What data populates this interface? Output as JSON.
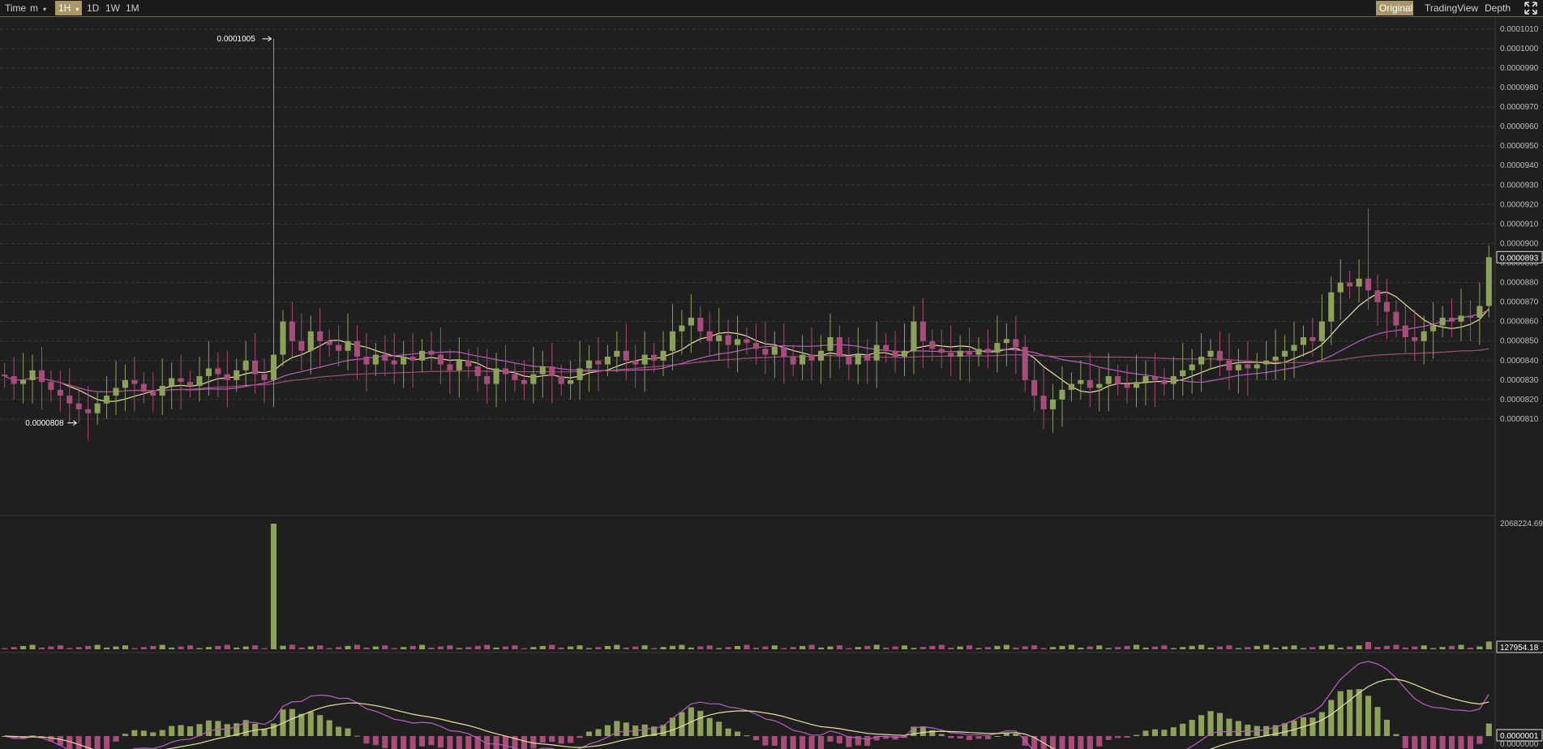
{
  "toolbar": {
    "time_label": "Time",
    "minute_label": "m",
    "interval_active": "1H",
    "interval_buttons": [
      "1D",
      "1W",
      "1M"
    ],
    "view_buttons": [
      "Original",
      "TradingView",
      "Depth"
    ],
    "active_view": "Original"
  },
  "colors": {
    "up": "#8ea15a",
    "down": "#a84c79",
    "ma_fast": "#e9df9f",
    "ma_mid": "#b85fc2",
    "ma_slow": "#a04f79",
    "grid": "#3a3a3a",
    "background": "#1f1f1f",
    "accent": "#a89668"
  },
  "chart_data": [
    {
      "type": "candlestick",
      "panel": "price",
      "title": "",
      "ylim": [
        8.05e-05,
        0.0001012
      ],
      "y_ticks": [
        "0.0001010",
        "0.0001000",
        "0.0000990",
        "0.0000980",
        "0.0000970",
        "0.0000960",
        "0.0000950",
        "0.0000940",
        "0.0000930",
        "0.0000920",
        "0.0000910",
        "0.0000900",
        "0.0000890",
        "0.0000880",
        "0.0000870",
        "0.0000860",
        "0.0000850",
        "0.0000840",
        "0.0000830",
        "0.0000820",
        "0.0000810"
      ],
      "grid": true,
      "candle_count": 165,
      "close_estimates": [
        8.32e-05,
        8.28e-05,
        8.3e-05,
        8.35e-05,
        8.29e-05,
        8.25e-05,
        8.22e-05,
        8.18e-05,
        8.15e-05,
        8.13e-05,
        8.18e-05,
        8.22e-05,
        8.26e-05,
        8.3e-05,
        8.28e-05,
        8.24e-05,
        8.22e-05,
        8.27e-05,
        8.31e-05,
        8.29e-05,
        8.27e-05,
        8.32e-05,
        8.36e-05,
        8.33e-05,
        8.3e-05,
        8.35e-05,
        8.4e-05,
        8.33e-05,
        8.3e-05,
        8.43e-05,
        8.6e-05,
        8.5e-05,
        8.45e-05,
        8.55e-05,
        8.5e-05,
        8.48e-05,
        8.45e-05,
        8.5e-05,
        8.42e-05,
        8.38e-05,
        8.43e-05,
        8.4e-05,
        8.38e-05,
        8.42e-05,
        8.4e-05,
        8.45e-05,
        8.43e-05,
        8.38e-05,
        8.35e-05,
        8.4e-05,
        8.37e-05,
        8.32e-05,
        8.28e-05,
        8.36e-05,
        8.33e-05,
        8.3e-05,
        8.28e-05,
        8.33e-05,
        8.37e-05,
        8.32e-05,
        8.28e-05,
        8.3e-05,
        8.36e-05,
        8.4e-05,
        8.38e-05,
        8.42e-05,
        8.45e-05,
        8.4e-05,
        8.38e-05,
        8.43e-05,
        8.4e-05,
        8.45e-05,
        8.55e-05,
        8.58e-05,
        8.62e-05,
        8.55e-05,
        8.5e-05,
        8.53e-05,
        8.48e-05,
        8.51e-05,
        8.49e-05,
        8.46e-05,
        8.43e-05,
        8.47e-05,
        8.42e-05,
        8.38e-05,
        8.43e-05,
        8.4e-05,
        8.45e-05,
        8.52e-05,
        8.42e-05,
        8.38e-05,
        8.43e-05,
        8.4e-05,
        8.48e-05,
        8.45e-05,
        8.42e-05,
        8.45e-05,
        8.6e-05,
        8.5e-05,
        8.46e-05,
        8.44e-05,
        8.42e-05,
        8.45e-05,
        8.43e-05,
        8.46e-05,
        8.44e-05,
        8.49e-05,
        8.51e-05,
        8.47e-05,
        8.3e-05,
        8.22e-05,
        8.15e-05,
        8.2e-05,
        8.25e-05,
        8.28e-05,
        8.3e-05,
        8.26e-05,
        8.28e-05,
        8.32e-05,
        8.28e-05,
        8.26e-05,
        8.29e-05,
        8.32e-05,
        8.3e-05,
        8.28e-05,
        8.32e-05,
        8.35e-05,
        8.38e-05,
        8.42e-05,
        8.45e-05,
        8.4e-05,
        8.35e-05,
        8.38e-05,
        8.36e-05,
        8.38e-05,
        8.4e-05,
        8.42e-05,
        8.45e-05,
        8.48e-05,
        8.52e-05,
        8.5e-05,
        8.6e-05,
        8.75e-05,
        8.8e-05,
        8.78e-05,
        8.82e-05,
        8.76e-05,
        8.7e-05,
        8.65e-05,
        8.58e-05,
        8.52e-05,
        8.5e-05,
        8.55e-05,
        8.58e-05,
        8.62e-05,
        8.6e-05,
        8.63e-05,
        8.62e-05,
        8.68e-05,
        8.93e-05
      ],
      "annotations": [
        {
          "label": "0.0001005",
          "value": 0.0001005,
          "kind": "high"
        },
        {
          "label": "0.0000808",
          "value": 8.08e-05,
          "kind": "low"
        }
      ],
      "last_price_label": "0.0000893",
      "moving_averages": [
        "fast",
        "mid",
        "slow"
      ]
    },
    {
      "type": "bar",
      "panel": "volume",
      "ylim": [
        0,
        2068224.69
      ],
      "top_label": "2068224.69",
      "last_value_label": "127954.18",
      "spike_value": 2068224.69
    },
    {
      "type": "macd",
      "panel": "indicator",
      "last_value_label": "0.0000001",
      "zero_label": "0.0000000"
    }
  ]
}
